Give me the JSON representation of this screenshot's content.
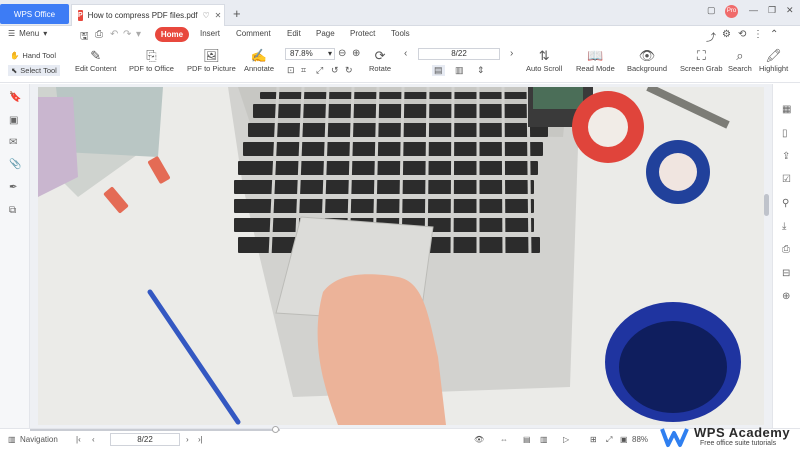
{
  "titlebar": {
    "brand_tab": "WPS Office",
    "doc_tab": "How to compress PDF files.pdf",
    "new_tab": "+",
    "avatar_text": "Pro"
  },
  "menurow": {
    "menu_label": "Menu",
    "tabs": [
      "Home",
      "Insert",
      "Comment",
      "Edit",
      "Page",
      "Protect",
      "Tools"
    ]
  },
  "toolbar": {
    "hand_tool": "Hand Tool",
    "select_tool": "Select Tool",
    "edit_content": "Edit Content",
    "pdf_to_office": "PDF to Office",
    "pdf_to_picture": "PDF to Picture",
    "annotate": "Annotate",
    "zoom": "87.8%",
    "rotate": "Rotate",
    "page": "8/22",
    "auto_scroll": "Auto Scroll",
    "read_mode": "Read Mode",
    "background": "Background",
    "screen_grab": "Screen Grab",
    "search": "Search",
    "highlight": "Highlight"
  },
  "statusbar": {
    "navigation": "Navigation",
    "page": "8/22",
    "zoom": "88%"
  },
  "branding": {
    "name": "WPS Academy",
    "tagline": "Free office suite tutorials"
  },
  "colors": {
    "accent": "#e8483d",
    "brand": "#3d7cf5"
  }
}
